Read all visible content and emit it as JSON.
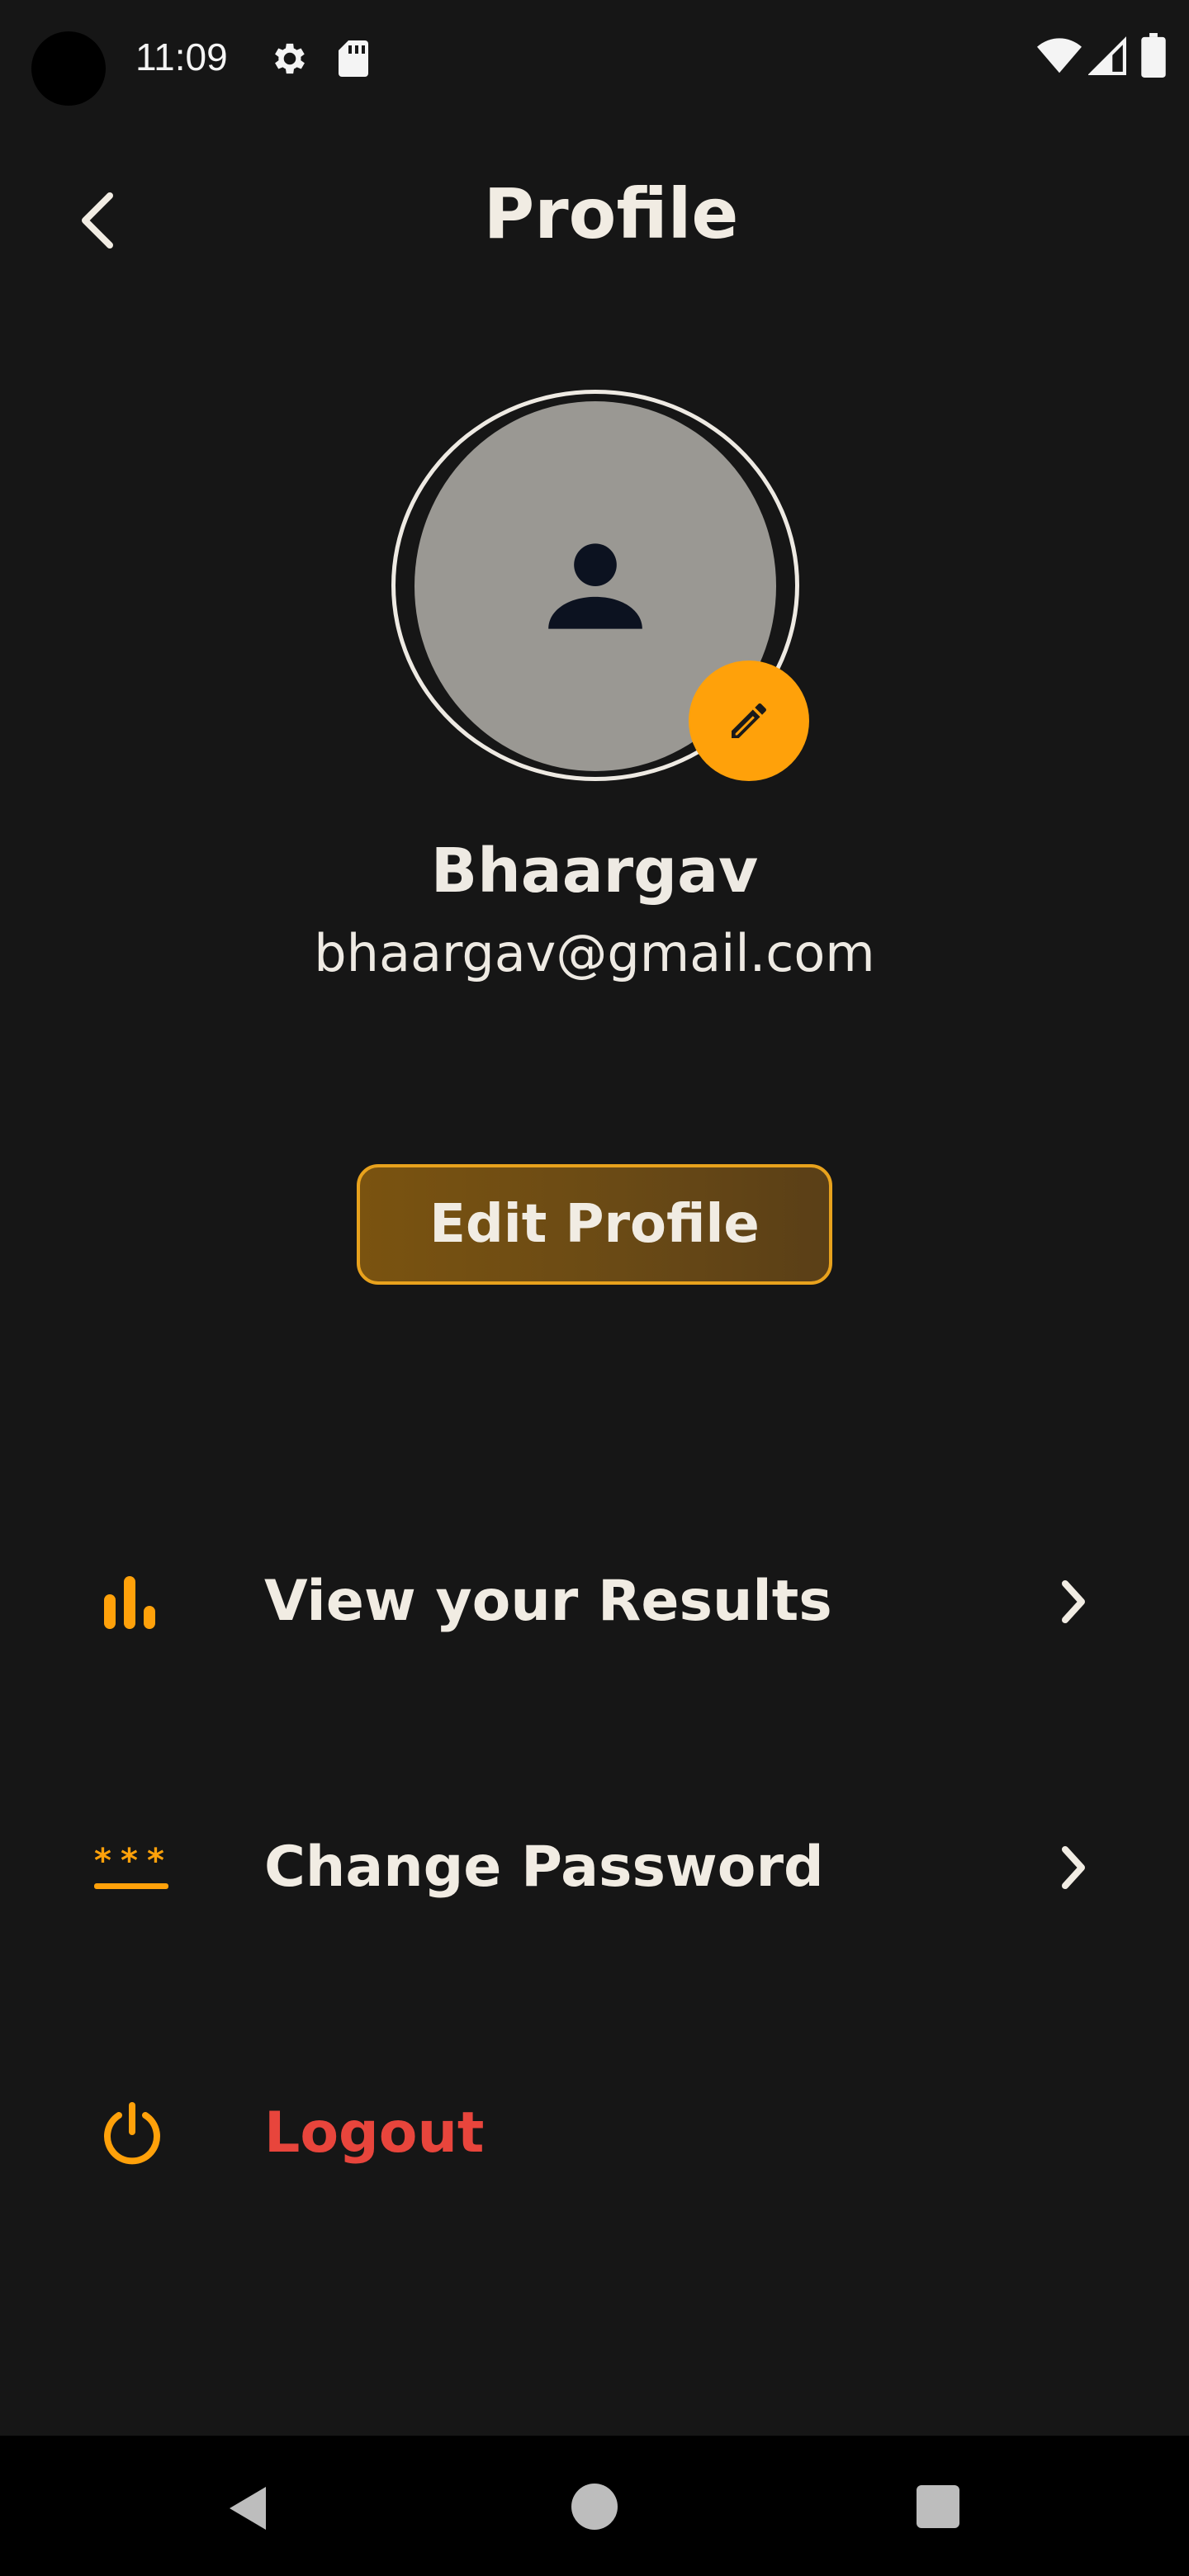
{
  "status_bar": {
    "time": "11:09",
    "icons": [
      "gear-icon",
      "sd-card-icon",
      "wifi-icon",
      "signal-icon",
      "battery-icon"
    ]
  },
  "header": {
    "title": "Profile",
    "back_icon": "chevron-left-icon"
  },
  "profile": {
    "name": "Bhaargav",
    "email": "bhaargav@gmail.com",
    "avatar_icon": "person-icon",
    "edit_avatar_icon": "pencil-icon"
  },
  "edit_profile_button": {
    "label": "Edit Profile"
  },
  "menu": [
    {
      "label": "View your Results",
      "icon": "bar-chart-icon",
      "has_chevron": true
    },
    {
      "label": "Change Password",
      "icon": "password-icon",
      "has_chevron": true
    },
    {
      "label": "Logout",
      "icon": "power-icon",
      "has_chevron": false
    }
  ],
  "colors": {
    "background": "#161616",
    "accent": "#ffa10a",
    "text": "#f1ece3",
    "logout": "#e8453c",
    "button_border": "#e8a21d"
  },
  "nav_bar": {
    "icons": [
      "nav-back-icon",
      "nav-home-icon",
      "nav-recents-icon"
    ]
  }
}
